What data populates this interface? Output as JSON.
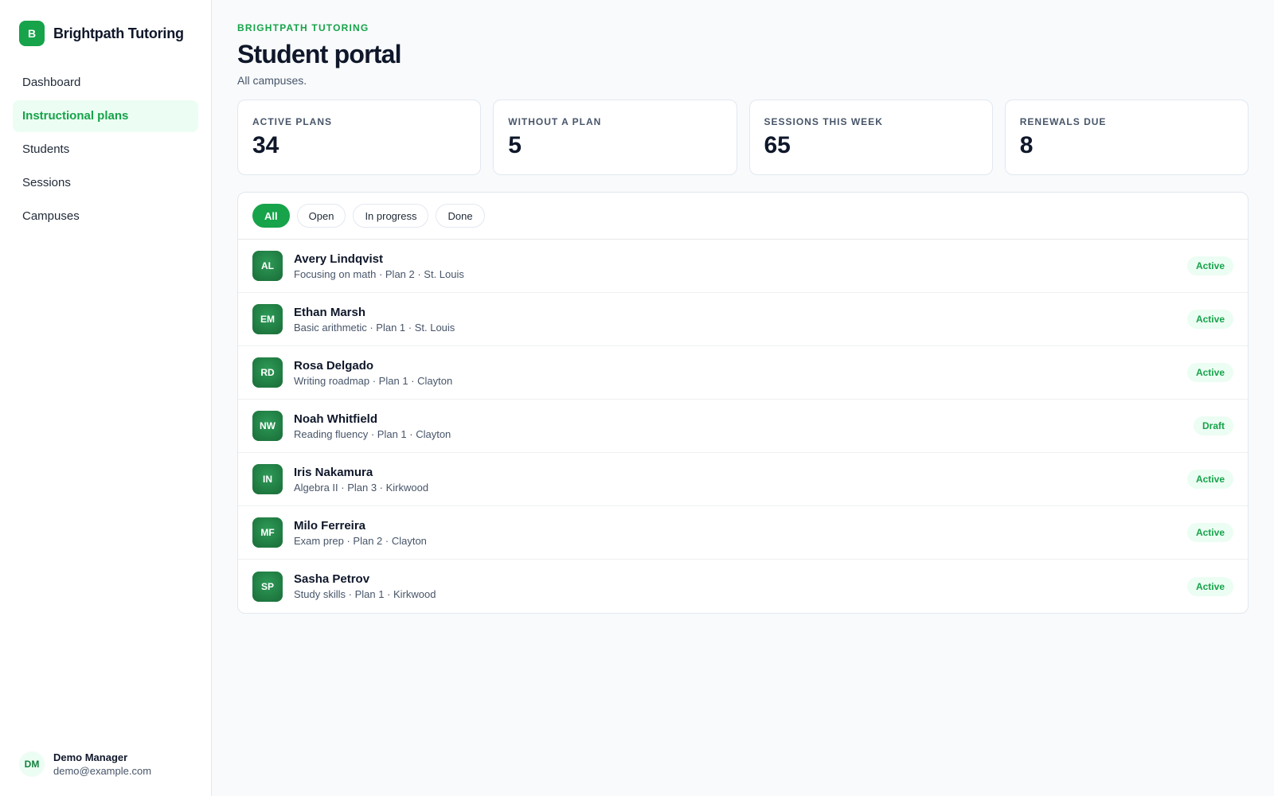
{
  "brand": {
    "logo_letter": "B",
    "name": "Brightpath Tutoring"
  },
  "sidebar": {
    "items": [
      {
        "label": "Dashboard",
        "active": false
      },
      {
        "label": "Instructional plans",
        "active": true
      },
      {
        "label": "Students",
        "active": false
      },
      {
        "label": "Sessions",
        "active": false
      },
      {
        "label": "Campuses",
        "active": false
      }
    ]
  },
  "user": {
    "initials": "DM",
    "name": "Demo Manager",
    "email": "demo@example.com"
  },
  "header": {
    "eyebrow": "BRIGHTPATH TUTORING",
    "title": "Student portal",
    "subtitle": "All campuses."
  },
  "stats": [
    {
      "label": "ACTIVE PLANS",
      "value": "34"
    },
    {
      "label": "WITHOUT A PLAN",
      "value": "5"
    },
    {
      "label": "SESSIONS THIS WEEK",
      "value": "65"
    },
    {
      "label": "RENEWALS DUE",
      "value": "8"
    }
  ],
  "filters": [
    {
      "label": "All",
      "active": true
    },
    {
      "label": "Open",
      "active": false
    },
    {
      "label": "In progress",
      "active": false
    },
    {
      "label": "Done",
      "active": false
    }
  ],
  "students": [
    {
      "initials": "AL",
      "name": "Avery Lindqvist",
      "meta": "Focusing on math · Plan 2 · St. Louis",
      "status": "Active"
    },
    {
      "initials": "EM",
      "name": "Ethan Marsh",
      "meta": "Basic arithmetic · Plan 1 · St. Louis",
      "status": "Active"
    },
    {
      "initials": "RD",
      "name": "Rosa Delgado",
      "meta": "Writing roadmap · Plan 1 · Clayton",
      "status": "Active"
    },
    {
      "initials": "NW",
      "name": "Noah Whitfield",
      "meta": "Reading fluency · Plan 1 · Clayton",
      "status": "Draft"
    },
    {
      "initials": "IN",
      "name": "Iris Nakamura",
      "meta": "Algebra II · Plan 3 · Kirkwood",
      "status": "Active"
    },
    {
      "initials": "MF",
      "name": "Milo Ferreira",
      "meta": "Exam prep · Plan 2 · Clayton",
      "status": "Active"
    },
    {
      "initials": "SP",
      "name": "Sasha Petrov",
      "meta": "Study skills · Plan 1 · Kirkwood",
      "status": "Active"
    }
  ],
  "colors": {
    "accent": "#16a34a",
    "accent_soft": "#ecfdf3"
  }
}
